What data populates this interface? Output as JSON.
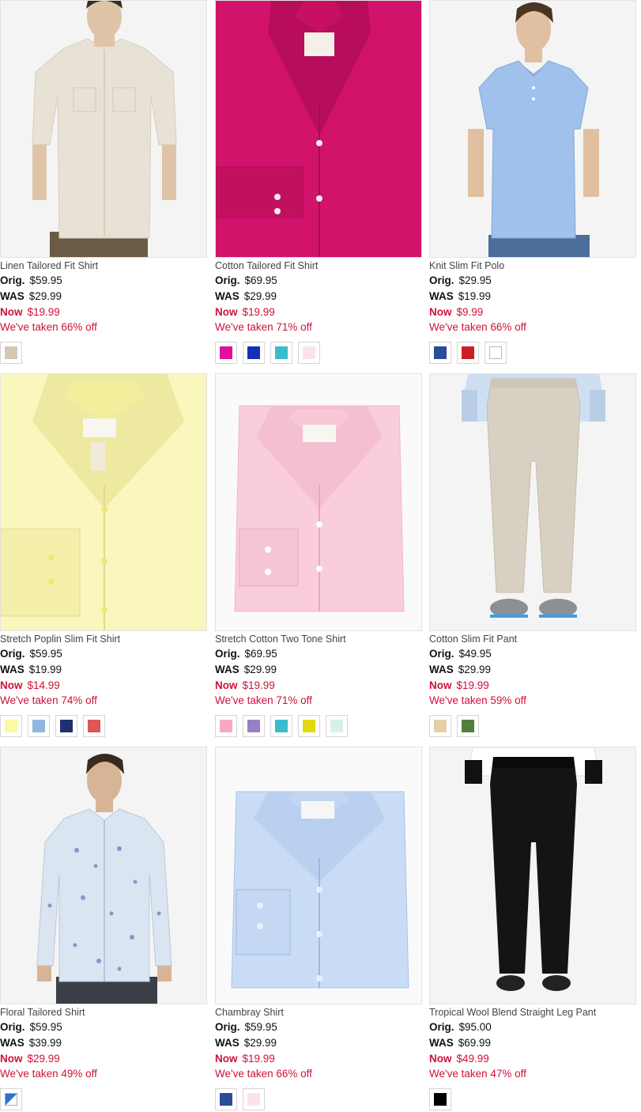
{
  "labels": {
    "orig": "Orig.",
    "was": "WAS",
    "now": "Now"
  },
  "products": [
    {
      "name": "Linen Tailored Fit Shirt",
      "orig": "$59.95",
      "was": "$29.99",
      "now": "$19.99",
      "discount": "We've taken 66% off",
      "image": "man-linen-shirt-photo",
      "colors": [
        "#d4c8b4"
      ]
    },
    {
      "name": "Cotton Tailored Fit Shirt",
      "orig": "$69.95",
      "was": "$29.99",
      "now": "$19.99",
      "discount": "We've taken 71% off",
      "image": "folded-shirt-photo",
      "colors": [
        "#e0119e",
        "#1530b8",
        "#3bbccb",
        "#fbe3ee"
      ]
    },
    {
      "name": "Knit Slim Fit Polo",
      "orig": "$29.95",
      "was": "$19.99",
      "now": "$9.99",
      "discount": "We've taken 66% off",
      "image": "man-polo-photo",
      "colors": [
        "#2b4c96",
        "#cc1f25",
        "#ffffff"
      ]
    },
    {
      "name": "Stretch Poplin Slim Fit Shirt",
      "orig": "$59.95",
      "was": "$19.99",
      "now": "$14.99",
      "discount": "We've taken 74% off",
      "image": "folded-shirt-photo",
      "colors": [
        "#fbf9a3",
        "#8eb8e2",
        "#1f2f70",
        "#e05555"
      ]
    },
    {
      "name": "Stretch Cotton Two Tone Shirt",
      "orig": "$69.95",
      "was": "$29.99",
      "now": "$19.99",
      "discount": "We've taken 71% off",
      "image": "folded-shirt-photo",
      "colors": [
        "#f7a8c4",
        "#9a7fc4",
        "#3bbccb",
        "#e6d80f",
        "#d7f0ea"
      ]
    },
    {
      "name": "Cotton Slim Fit Pant",
      "orig": "$49.95",
      "was": "$29.99",
      "now": "$19.99",
      "discount": "We've taken 59% off",
      "image": "khaki-pant-photo",
      "colors": [
        "#e6cfa4",
        "#557e3e"
      ]
    },
    {
      "name": "Floral Tailored Shirt",
      "orig": "$59.95",
      "was": "$39.99",
      "now": "$29.99",
      "discount": "We've taken 49% off",
      "image": "man-floral-shirt-photo",
      "colors": [
        "pattern"
      ]
    },
    {
      "name": "Chambray Shirt",
      "orig": "$59.95",
      "was": "$29.99",
      "now": "$19.99",
      "discount": "We've taken 66% off",
      "image": "folded-shirt-photo",
      "colors": [
        "#2b4c96",
        "#fbe3ee"
      ]
    },
    {
      "name": "Tropical Wool Blend Straight Leg Pant",
      "orig": "$95.00",
      "was": "$69.99",
      "now": "$49.99",
      "discount": "We've taken 47% off",
      "image": "black-pant-photo",
      "colors": [
        "#000000"
      ]
    }
  ]
}
